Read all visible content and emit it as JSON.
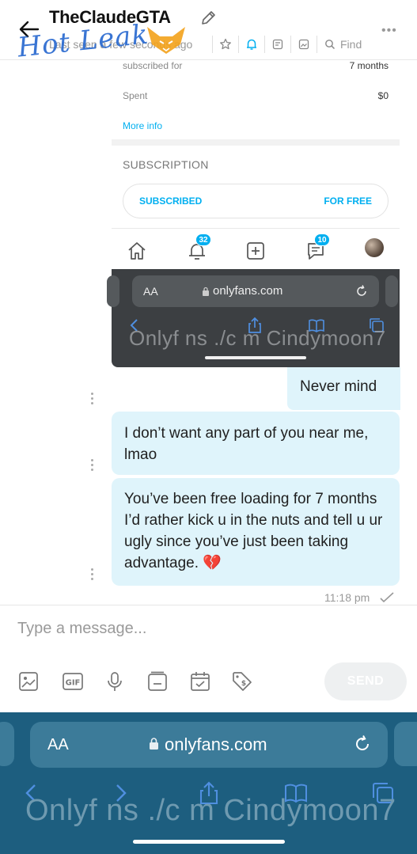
{
  "header": {
    "title": "TheClaudeGTA",
    "last_seen": "Last seen a few seconds ago",
    "find_label": "Find",
    "icons": [
      "back-arrow-icon",
      "pencil-icon",
      "more-icon",
      "star-icon",
      "bell-icon",
      "notes-icon",
      "gallery-icon",
      "search-icon"
    ],
    "accent": "#00aff0"
  },
  "watermark": {
    "text": "Hot Leak"
  },
  "embedded_profile": {
    "subscribed_label": "subscribed for",
    "subscribed_value": "7 months",
    "spent_label": "Spent",
    "spent_value": "$0",
    "more_info": "More info",
    "subscription_heading": "SUBSCRIPTION",
    "subscribed_button": "SUBSCRIBED",
    "price_label": "FOR FREE",
    "notification_badge": "32",
    "messages_badge": "10"
  },
  "embedded_browser": {
    "aa": "AA",
    "url": "onlyfans.com",
    "watermark_text": "Onlyf ns ./c m Cindymoon7"
  },
  "messages": [
    {
      "text": "Never mind",
      "direction": "outgoing"
    },
    {
      "text": "I don’t want any part of you near me, lmao",
      "direction": "incoming"
    },
    {
      "text": "You’ve been free loading for 7 months I’d rather kick u in the nuts and tell u ur ugly since you’ve just been taking advantage. 💔",
      "direction": "incoming"
    }
  ],
  "timestamp": "11:18 pm",
  "composer": {
    "placeholder": "Type a message...",
    "send_label": "SEND",
    "tools": [
      "image-icon",
      "gif-icon",
      "microphone-icon",
      "media-vault-icon",
      "calendar-icon",
      "price-tag-icon"
    ]
  },
  "browser_bar": {
    "aa": "AA",
    "url": "onlyfans.com",
    "watermark_text": "Onlyf ns ./c m Cindymoon7"
  }
}
